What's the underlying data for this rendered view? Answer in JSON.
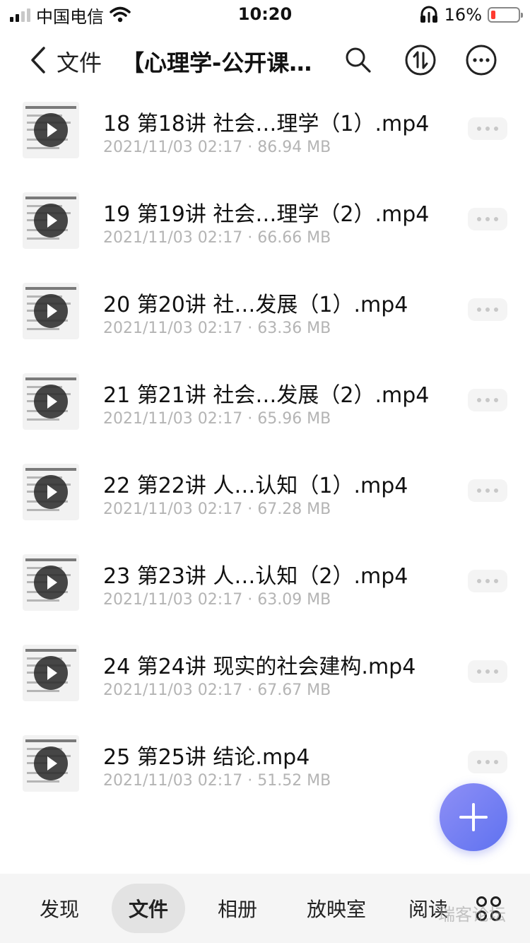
{
  "status_bar": {
    "carrier": "中国电信",
    "time": "10:20",
    "battery_percent": "16%",
    "battery_level": 0.16,
    "icons": [
      "signal-icon",
      "wifi-icon",
      "headphones-icon",
      "battery-icon"
    ]
  },
  "nav": {
    "back_label": "文件",
    "title": "【心理学-公开课…",
    "icons": [
      "back-chevron-icon",
      "search-icon",
      "sort-icon",
      "more-icon"
    ]
  },
  "files": [
    {
      "name": "18 第18讲 社会…理学（1）.mp4",
      "date": "2021/11/03 02:17",
      "size": "86.94 MB"
    },
    {
      "name": "19 第19讲 社会…理学（2）.mp4",
      "date": "2021/11/03 02:17",
      "size": "66.66 MB"
    },
    {
      "name": " 20 第20讲 社…发展（1）.mp4",
      "date": "2021/11/03 02:17",
      "size": "63.36 MB"
    },
    {
      "name": "21 第21讲 社会…发展（2）.mp4",
      "date": "2021/11/03 02:17",
      "size": "65.96 MB"
    },
    {
      "name": " 22 第22讲 人…认知（1）.mp4",
      "date": "2021/11/03 02:17",
      "size": "67.28 MB"
    },
    {
      "name": " 23 第23讲 人…认知（2）.mp4",
      "date": "2021/11/03 02:17",
      "size": "63.09 MB"
    },
    {
      "name": "24 第24讲 现实的社会建构.mp4",
      "date": "2021/11/03 02:17",
      "size": "67.67 MB"
    },
    {
      "name": "25 第25讲 结论.mp4",
      "date": "2021/11/03 02:17",
      "size": "51.52 MB"
    }
  ],
  "meta_separator": "·",
  "tabs": [
    {
      "label": "发现",
      "active": false
    },
    {
      "label": "文件",
      "active": true
    },
    {
      "label": "相册",
      "active": false
    },
    {
      "label": "放映室",
      "active": false
    },
    {
      "label": "阅读",
      "active": false
    }
  ],
  "watermark": "瑞客论坛",
  "colors": {
    "accent": "#6b7bf2",
    "battery_low": "#ff3b30",
    "meta_text": "#b4b4b4"
  }
}
